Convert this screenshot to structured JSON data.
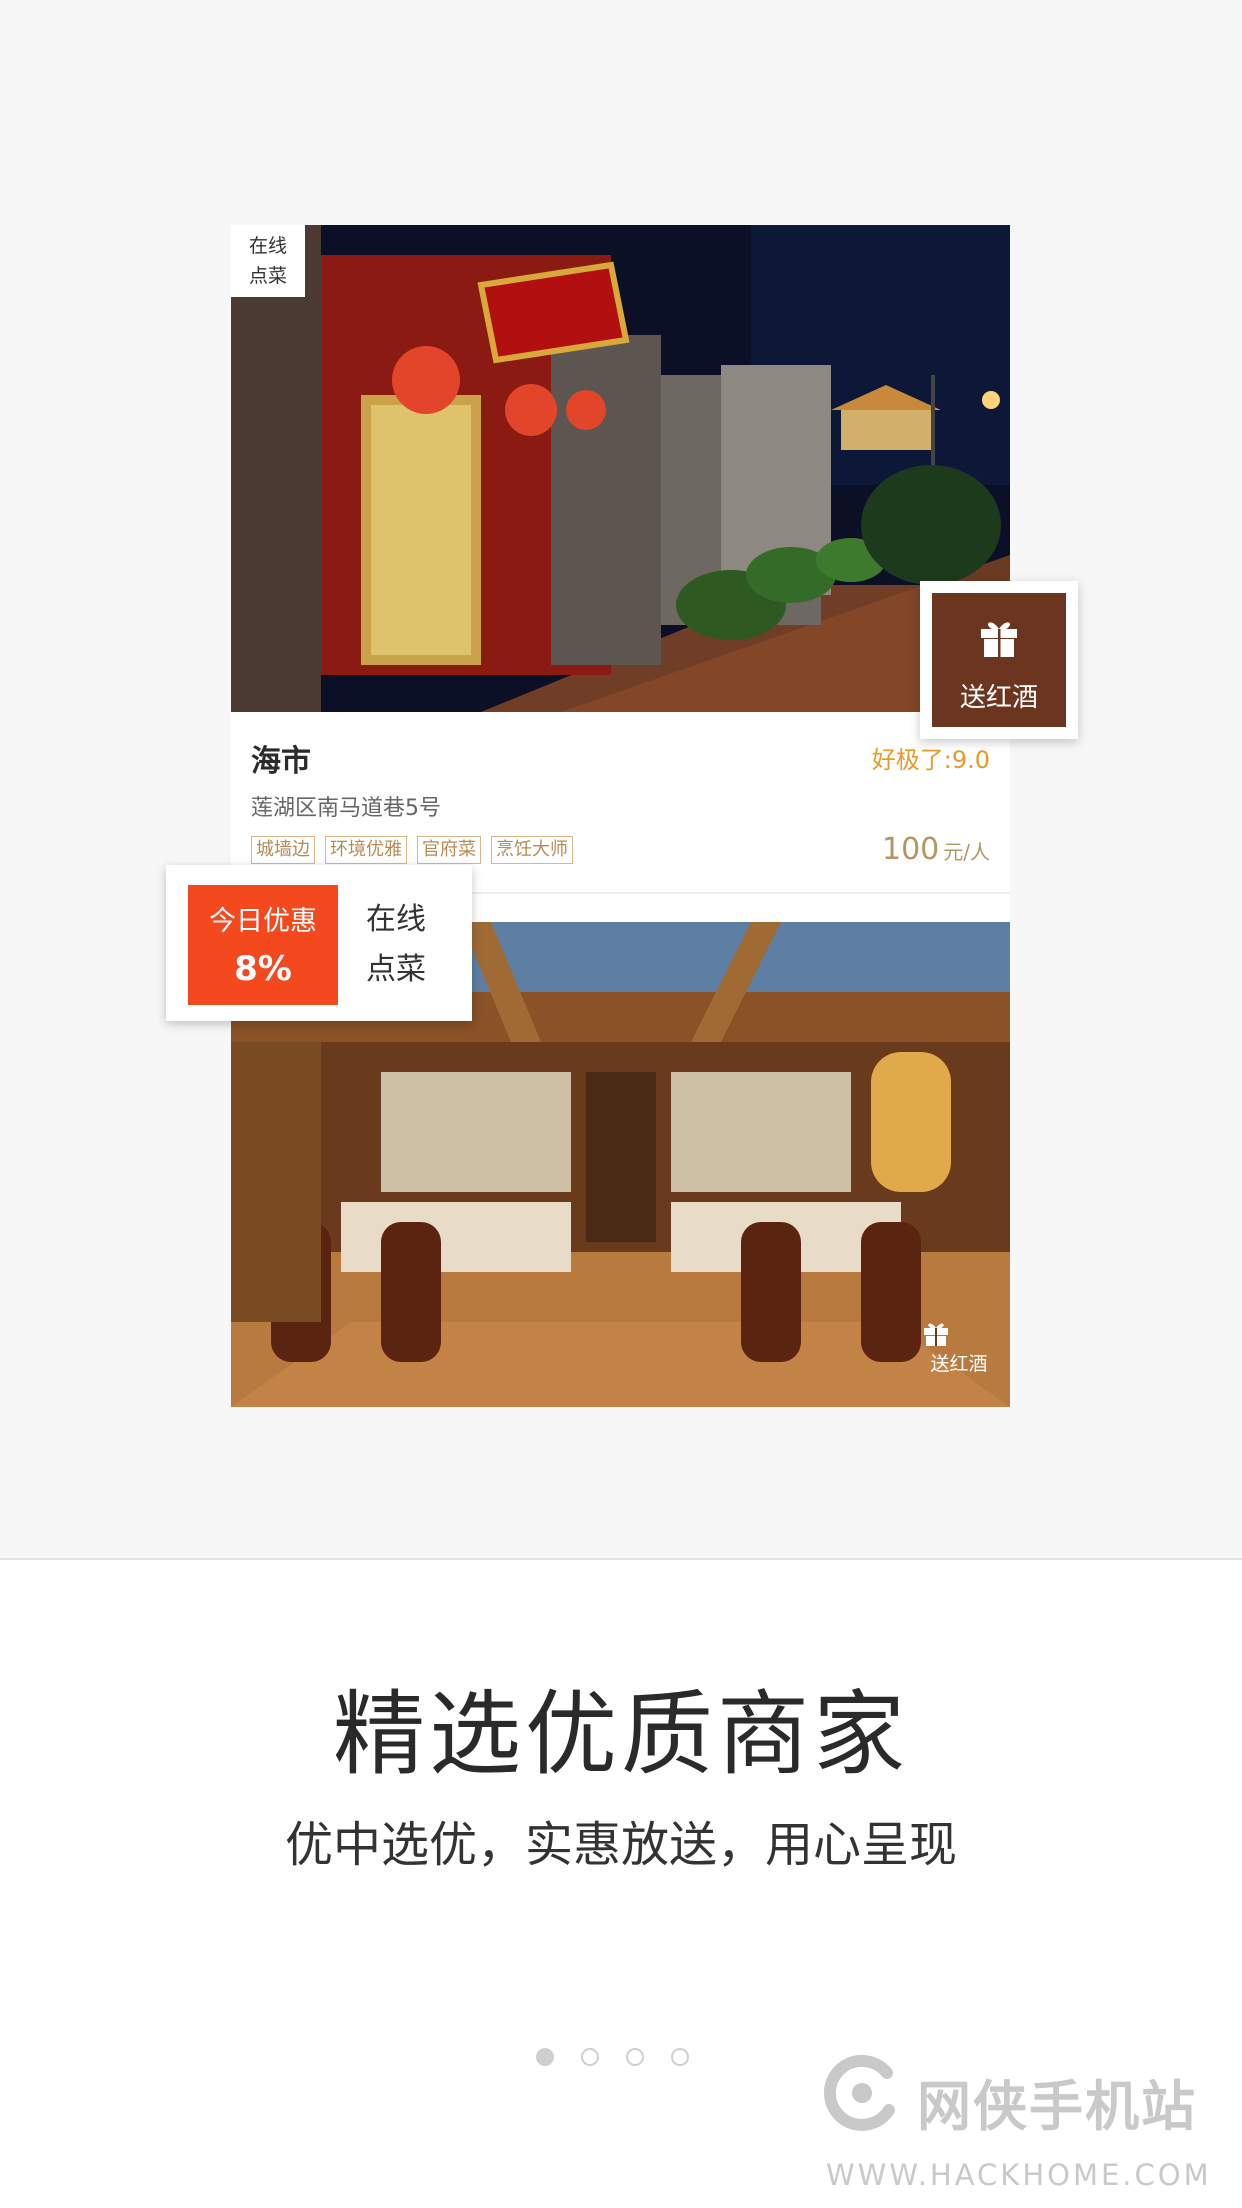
{
  "restaurant": {
    "name": "海市",
    "rating": "好极了:9.0",
    "address": "莲湖区南马道巷5号",
    "tags": [
      "城墙边",
      "环境优雅",
      "官府菜",
      "烹饪大师"
    ],
    "price_value": "100",
    "price_unit": "元/人",
    "corner_tag_line1": "在线",
    "corner_tag_line2": "点菜"
  },
  "gift_badge": {
    "label": "送红酒",
    "icon": "gift-icon"
  },
  "deal_badge": {
    "title": "今日优惠",
    "percent": "8%",
    "right_line1": "在线",
    "right_line2": "点菜",
    "accent_color": "#f4481f"
  },
  "second_card": {
    "gift_label": "送红酒",
    "icon": "gift-icon"
  },
  "headline": "精选优质商家",
  "subline": "优中选优，实惠放送，用心呈现",
  "pager": {
    "count": 4,
    "active_index": 0
  },
  "watermark": {
    "text": "网侠手机站",
    "url": "WWW.HACKHOME.COM"
  }
}
